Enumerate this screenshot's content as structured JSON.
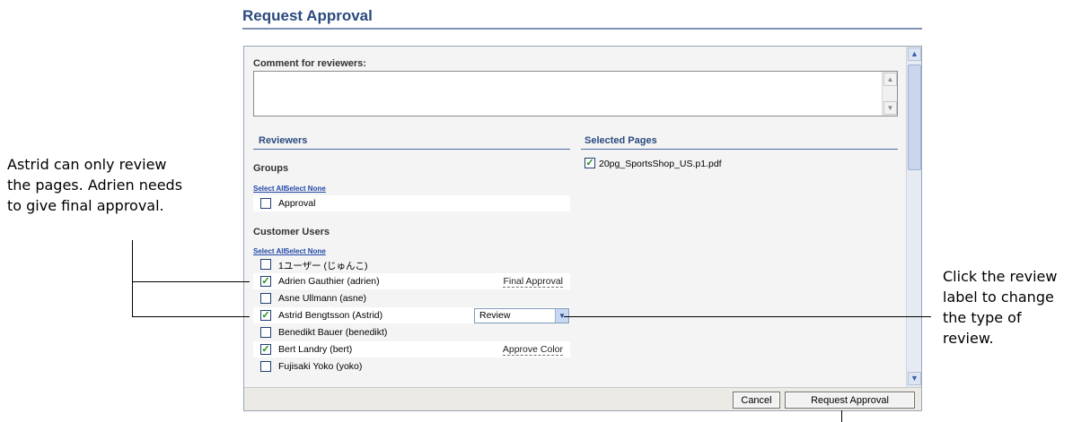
{
  "page": {
    "title": "Request Approval"
  },
  "comment": {
    "label": "Comment for reviewers:",
    "value": ""
  },
  "reviewers": {
    "heading": "Reviewers",
    "groups": {
      "heading": "Groups",
      "select_all": "Select All",
      "select_none": "Select None",
      "items": [
        {
          "name": "Approval",
          "checked": false
        }
      ]
    },
    "customer_users": {
      "heading": "Customer Users",
      "select_all": "Select All",
      "select_none": "Select None",
      "items": [
        {
          "name": "1ユーザー (じゅんこ)",
          "checked": false,
          "review_type": ""
        },
        {
          "name": "Adrien Gauthier (adrien)",
          "checked": true,
          "review_type": "Final Approval"
        },
        {
          "name": "Asne Ullmann (asne)",
          "checked": false,
          "review_type": ""
        },
        {
          "name": "Astrid Bengtsson (Astrid)",
          "checked": true,
          "review_type": "Review"
        },
        {
          "name": "Benedikt Bauer (benedikt)",
          "checked": false,
          "review_type": ""
        },
        {
          "name": "Bert Landry (bert)",
          "checked": true,
          "review_type": "Approve Color"
        },
        {
          "name": "Fujisaki Yoko (yoko)",
          "checked": false,
          "review_type": ""
        }
      ]
    }
  },
  "selected_pages": {
    "heading": "Selected Pages",
    "items": [
      {
        "name": "20pg_SportsShop_US.p1.pdf",
        "checked": true
      }
    ]
  },
  "buttons": {
    "cancel": "Cancel",
    "request_approval": "Request Approval"
  },
  "annotations": {
    "left": [
      "Astrid can only review",
      "the pages. Adrien needs",
      "to give final approval."
    ],
    "right": [
      "Click the review",
      "label to change",
      "the type of",
      "review."
    ]
  },
  "icons": {
    "checkbox_checked": "checkmark-icon",
    "scroll_up": "arrow-up-icon",
    "scroll_down": "arrow-down-icon",
    "dropdown": "chevron-down-icon"
  },
  "colors": {
    "title": "#2a4a7f",
    "link": "#2448a8",
    "check": "#1b8f1b"
  }
}
